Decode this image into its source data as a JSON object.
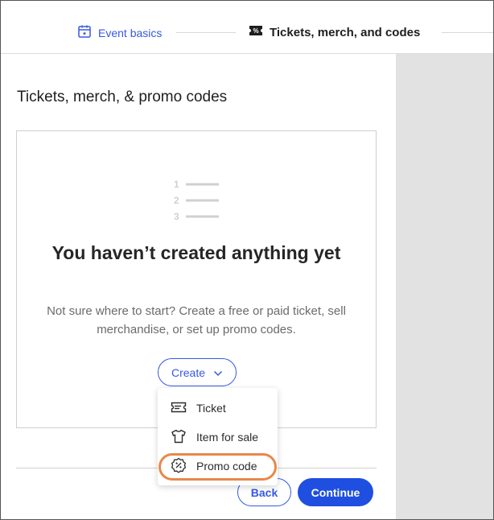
{
  "stepper": {
    "step1_label": "Event basics",
    "step1_icon": "calendar-icon",
    "step2_label": "Tickets, merch, and codes",
    "step2_icon": "ticket-icon"
  },
  "main": {
    "title": "Tickets, merch, & promo codes",
    "empty_heading": "You haven’t created anything yet",
    "empty_description": "Not sure where to start? Create a free or paid ticket, sell merchandise, or set up promo codes.",
    "empty_icon_numbers": [
      "1",
      "2",
      "3"
    ],
    "create_button": "Create"
  },
  "create_menu": {
    "items": [
      {
        "label": "Ticket",
        "icon": "ticket-icon"
      },
      {
        "label": "Item for sale",
        "icon": "shirt-icon"
      },
      {
        "label": "Promo code",
        "icon": "discount-badge-icon"
      }
    ],
    "highlighted_item": "Promo code"
  },
  "footer": {
    "back_label": "Back",
    "continue_label": "Continue"
  },
  "colors": {
    "accent": "#3659e3",
    "primary_button": "#1f4fe0",
    "highlight_ring": "#e8884a",
    "side_panel": "#e2e2e2"
  }
}
